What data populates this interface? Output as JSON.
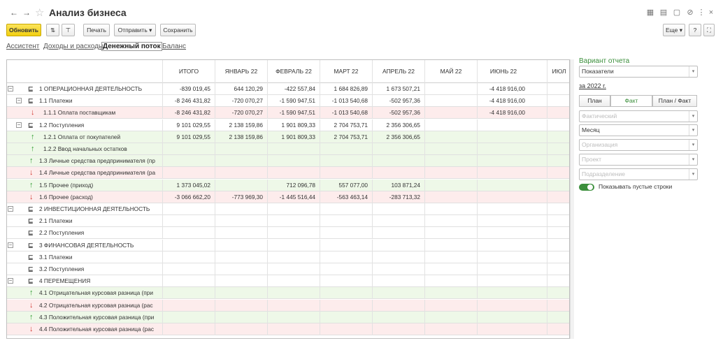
{
  "window": {
    "title": "Анализ бизнеса"
  },
  "toolbar": {
    "refresh": "Обновить",
    "print": "Печать",
    "send": "Отправить",
    "save": "Сохранить",
    "more": "Еще",
    "help": "?"
  },
  "tabs": [
    "Ассистент",
    "Доходы и расходы",
    "Денежный поток",
    "Баланс"
  ],
  "table": {
    "columns": [
      "ИТОГО",
      "ЯНВАРЬ 22",
      "ФЕВРАЛЬ 22",
      "МАРТ 22",
      "АПРЕЛЬ 22",
      "МАЙ 22",
      "ИЮНЬ 22",
      "ИЮЛ"
    ],
    "rows": [
      {
        "label": "1  ОПЕРАЦИОННАЯ ДЕЯТЕЛЬНОСТЬ",
        "kind": "group",
        "level": 0,
        "values": [
          "-839 019,45",
          "644 120,29",
          "-422 557,84",
          "1 684 826,89",
          "1 673 507,21",
          "",
          "-4 418 916,00",
          ""
        ]
      },
      {
        "label": "1.1  Платежи",
        "kind": "group",
        "level": 1,
        "values": [
          "-8 246 431,82",
          "-720 070,27",
          "-1 590 947,51",
          "-1 013 540,68",
          "-502 957,36",
          "",
          "-4 418 916,00",
          ""
        ]
      },
      {
        "label": "1.1.1  Оплата поставщикам",
        "kind": "out",
        "level": 2,
        "values": [
          "-8 246 431,82",
          "-720 070,27",
          "-1 590 947,51",
          "-1 013 540,68",
          "-502 957,36",
          "",
          "-4 418 916,00",
          ""
        ]
      },
      {
        "label": "1.2  Поступления",
        "kind": "group",
        "level": 1,
        "values": [
          "9 101 029,55",
          "2 138 159,86",
          "1 901 809,33",
          "2 704 753,71",
          "2 356 306,65",
          "",
          "",
          ""
        ]
      },
      {
        "label": "1.2.1  Оплата от покупателей",
        "kind": "in",
        "level": 2,
        "values": [
          "9 101 029,55",
          "2 138 159,86",
          "1 901 809,33",
          "2 704 753,71",
          "2 356 306,65",
          "",
          "",
          ""
        ]
      },
      {
        "label": "1.2.2  Ввод начальных остатков",
        "kind": "in",
        "level": 2,
        "values": [
          "",
          "",
          "",
          "",
          "",
          "",
          "",
          ""
        ]
      },
      {
        "label": "1.3  Личные средства предпринимателя (пр",
        "kind": "in",
        "level": 1,
        "values": [
          "",
          "",
          "",
          "",
          "",
          "",
          "",
          ""
        ]
      },
      {
        "label": "1.4  Личные средства предпринимателя (ра",
        "kind": "out",
        "level": 1,
        "values": [
          "",
          "",
          "",
          "",
          "",
          "",
          "",
          ""
        ]
      },
      {
        "label": "1.5  Прочее (приход)",
        "kind": "in",
        "level": 1,
        "values": [
          "1 373 045,02",
          "",
          "712 096,78",
          "557 077,00",
          "103 871,24",
          "",
          "",
          ""
        ]
      },
      {
        "label": "1.6  Прочее (расход)",
        "kind": "out",
        "level": 1,
        "values": [
          "-3 066 662,20",
          "-773 969,30",
          "-1 445 516,44",
          "-563 463,14",
          "-283 713,32",
          "",
          "",
          ""
        ]
      },
      {
        "label": "2  ИНВЕСТИЦИОННАЯ ДЕЯТЕЛЬНОСТЬ",
        "kind": "group",
        "level": 0,
        "values": [
          "",
          "",
          "",
          "",
          "",
          "",
          "",
          ""
        ]
      },
      {
        "label": "2.1  Платежи",
        "kind": "group",
        "level": 1,
        "values": [
          "",
          "",
          "",
          "",
          "",
          "",
          "",
          ""
        ]
      },
      {
        "label": "2.2  Поступления",
        "kind": "group",
        "level": 1,
        "values": [
          "",
          "",
          "",
          "",
          "",
          "",
          "",
          ""
        ]
      },
      {
        "label": "3  ФИНАНСОВАЯ ДЕЯТЕЛЬНОСТЬ",
        "kind": "group",
        "level": 0,
        "values": [
          "",
          "",
          "",
          "",
          "",
          "",
          "",
          ""
        ]
      },
      {
        "label": "3.1  Платежи",
        "kind": "group",
        "level": 1,
        "values": [
          "",
          "",
          "",
          "",
          "",
          "",
          "",
          ""
        ]
      },
      {
        "label": "3.2  Поступления",
        "kind": "group",
        "level": 1,
        "values": [
          "",
          "",
          "",
          "",
          "",
          "",
          "",
          ""
        ]
      },
      {
        "label": "4  ПЕРЕМЕЩЕНИЯ",
        "kind": "group",
        "level": 0,
        "values": [
          "",
          "",
          "",
          "",
          "",
          "",
          "",
          ""
        ]
      },
      {
        "label": "4.1  Отрицательная курсовая разница (при",
        "kind": "in",
        "level": 1,
        "values": [
          "",
          "",
          "",
          "",
          "",
          "",
          "",
          ""
        ]
      },
      {
        "label": "4.2  Отрицательная курсовая разница (рас",
        "kind": "out",
        "level": 1,
        "values": [
          "",
          "",
          "",
          "",
          "",
          "",
          "",
          ""
        ]
      },
      {
        "label": "4.3  Положительная курсовая разница (при",
        "kind": "in",
        "level": 1,
        "values": [
          "",
          "",
          "",
          "",
          "",
          "",
          "",
          ""
        ]
      },
      {
        "label": "4.4  Положительная курсовая разница (рас",
        "kind": "out",
        "level": 1,
        "values": [
          "",
          "",
          "",
          "",
          "",
          "",
          "",
          ""
        ]
      }
    ]
  },
  "panel": {
    "title": "Вариант отчета",
    "variant": "Показатели",
    "period": "за 2022 г.",
    "modes": [
      "План",
      "Факт",
      "План / Факт"
    ],
    "active_mode": "Факт",
    "scenario_placeholder": "Фактический",
    "periodicity": "Месяц",
    "org_placeholder": "Организация",
    "project_placeholder": "Проект",
    "dept_placeholder": "Подразделение",
    "show_empty_label": "Показывать пустые строки",
    "show_empty": true
  },
  "colors": {
    "in_row": "#eef8e8",
    "out_row": "#fdecec",
    "accent": "#3c8f3c",
    "primary": "#f2cf10"
  }
}
